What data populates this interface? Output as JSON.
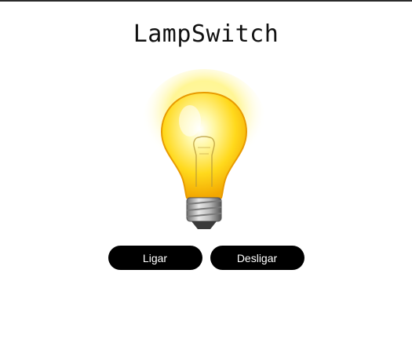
{
  "app": {
    "title": "LampSwitch"
  },
  "lamp": {
    "state": "on",
    "icon": "light-bulb-icon"
  },
  "controls": {
    "on_label": "Ligar",
    "off_label": "Desligar"
  },
  "colors": {
    "button_bg": "#000000",
    "button_text": "#ffffff",
    "glow": "#ffe94d",
    "bulb": "#ffd21a"
  }
}
